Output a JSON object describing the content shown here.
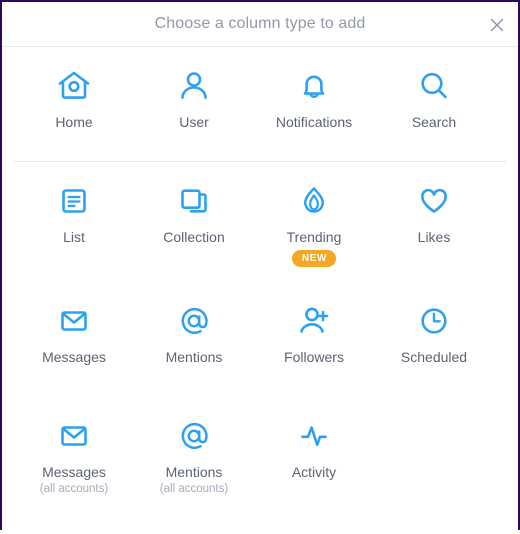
{
  "window": {
    "border_color": "#2b0a5e",
    "background": "#ffffff"
  },
  "header": {
    "title": "Choose a column type to add",
    "title_color": "#9198a9",
    "close_icon": "close-icon"
  },
  "theme": {
    "icon_color": "#2da1f0",
    "label_color": "#5c6375",
    "sublabel_color": "#a4abb9",
    "badge_color": "#f5a623",
    "divider_color": "#e2e7ed"
  },
  "sections": [
    {
      "name": "primary",
      "divider_above": false,
      "items": [
        {
          "label": "Home",
          "icon": "birdhouse-icon",
          "sublabel": null,
          "badge": null
        },
        {
          "label": "User",
          "icon": "user-icon",
          "sublabel": null,
          "badge": null
        },
        {
          "label": "Notifications",
          "icon": "bell-icon",
          "sublabel": null,
          "badge": null
        },
        {
          "label": "Search",
          "icon": "magnifier-icon",
          "sublabel": null,
          "badge": null
        }
      ]
    },
    {
      "name": "secondary-row-1",
      "divider_above": true,
      "items": [
        {
          "label": "List",
          "icon": "list-icon",
          "sublabel": null,
          "badge": null
        },
        {
          "label": "Collection",
          "icon": "collection-icon",
          "sublabel": null,
          "badge": null
        },
        {
          "label": "Trending",
          "icon": "flame-icon",
          "sublabel": null,
          "badge": "NEW"
        },
        {
          "label": "Likes",
          "icon": "heart-icon",
          "sublabel": null,
          "badge": null
        }
      ]
    },
    {
      "name": "secondary-row-2",
      "divider_above": false,
      "items": [
        {
          "label": "Messages",
          "icon": "envelope-icon",
          "sublabel": null,
          "badge": null
        },
        {
          "label": "Mentions",
          "icon": "at-sign-icon",
          "sublabel": null,
          "badge": null
        },
        {
          "label": "Followers",
          "icon": "user-plus-icon",
          "sublabel": null,
          "badge": null
        },
        {
          "label": "Scheduled",
          "icon": "clock-icon",
          "sublabel": null,
          "badge": null
        }
      ]
    },
    {
      "name": "secondary-row-3",
      "divider_above": false,
      "items": [
        {
          "label": "Messages",
          "icon": "envelope-icon",
          "sublabel": "(all accounts)",
          "badge": null
        },
        {
          "label": "Mentions",
          "icon": "at-sign-icon",
          "sublabel": "(all accounts)",
          "badge": null
        },
        {
          "label": "Activity",
          "icon": "activity-icon",
          "sublabel": null,
          "badge": null
        }
      ]
    }
  ]
}
